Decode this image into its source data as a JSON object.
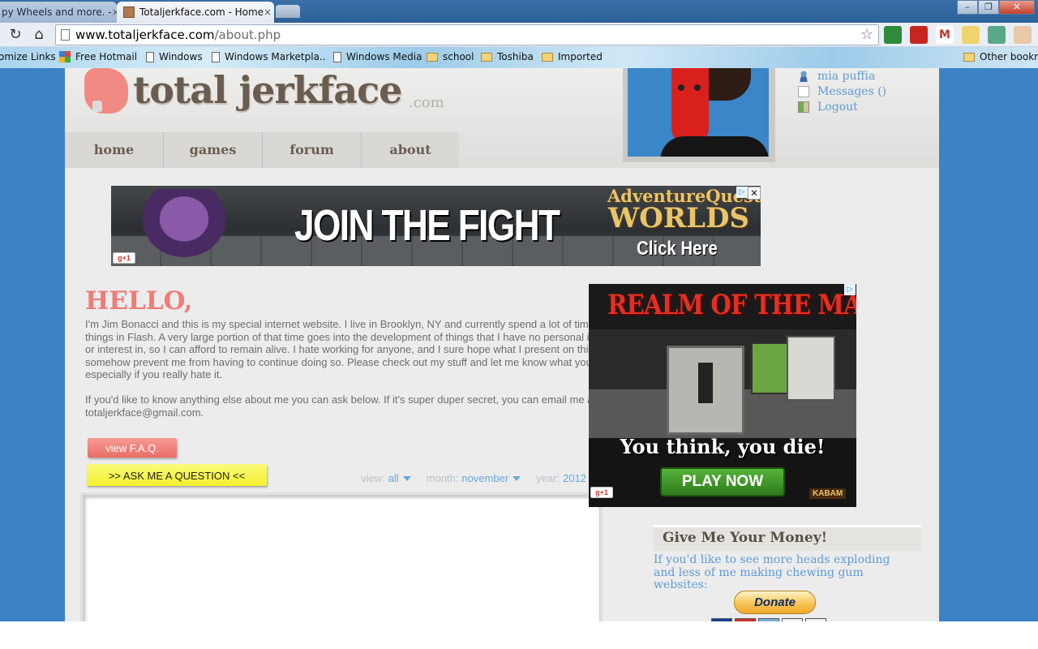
{
  "browser": {
    "tabs": [
      {
        "label": "py Wheels and more. -",
        "active": false
      },
      {
        "label": "Totaljerkface.com - Home",
        "active": true
      }
    ],
    "url_host": "www.totaljerkface.com",
    "url_path": "/about.php",
    "bookmarks": [
      {
        "label": "omize Links",
        "icon": "none"
      },
      {
        "label": "Free Hotmail",
        "icon": "windows-logo-icon"
      },
      {
        "label": "Windows",
        "icon": "page-icon"
      },
      {
        "label": "Windows Marketpla..",
        "icon": "page-icon"
      },
      {
        "label": "Windows Media",
        "icon": "page-icon"
      },
      {
        "label": "school",
        "icon": "folder-icon"
      },
      {
        "label": "Toshiba",
        "icon": "folder-icon"
      },
      {
        "label": "Imported",
        "icon": "folder-icon"
      }
    ],
    "other_bookmarks": "Other bookm",
    "close_glyph": "×",
    "reload_glyph": "↻",
    "home_glyph": "⌂",
    "star_glyph": "☆",
    "win_glyphs": {
      "minimize": "–",
      "restore": "❐",
      "close": "✕"
    }
  },
  "site": {
    "logo_text": "total jerkface",
    "logo_suffix": ".com",
    "nav": [
      "home",
      "games",
      "forum",
      "about"
    ],
    "user_menu": {
      "username": "mia puffia",
      "messages": "Messages ()",
      "logout": "Logout"
    },
    "top_ad": {
      "headline": "JOIN THE FIGHT",
      "brand_line1": "AdventureQuest",
      "brand_line2": "WORLDS",
      "cta": "Click Here",
      "gplus": "g+1",
      "choice": "▷",
      "close": "✕"
    },
    "side_ad": {
      "title": "REALM OF THE MAD GOD",
      "tagline": "You think, you die!",
      "cta": "PLAY NOW",
      "gplus": "g+1",
      "brand": "KABAM",
      "choice": "▷"
    },
    "about": {
      "heading": "HELLO,",
      "paragraph1": "I'm Jim Bonacci and this is my special internet website.  I live in Brooklyn, NY and currently spend a lot of time creating things in Flash.  A very large portion of that time goes into the development of things that I have no personal investment or interest in, so I can afford to remain alive.  I hate working for anyone, and I sure hope what I present on this site can somehow prevent me from having to continue doing so.  Please check out my stuff and let me know what you think ... especially if you really hate it.",
      "paragraph2": "If you'd like to know anything else about me you can ask below.  If it's super duper secret, you can email me at totaljerkface@gmail.com.",
      "faq_button": "view F.A.Q.",
      "ask_button": ">> ASK ME A QUESTION <<"
    },
    "filters": {
      "view_label": "view:",
      "view_value": "all",
      "month_label": "month:",
      "month_value": "november",
      "year_label": "year:",
      "year_value": "2012"
    },
    "money": {
      "heading": "Give Me Your Money!",
      "text": "If you'd like to see more heads exploding and less of me making chewing gum websites:",
      "donate_button": "Donate"
    }
  },
  "colors": {
    "background_blue": "#3c82c6",
    "heading_pink": "#f07c76",
    "link_blue": "#5e9bd6",
    "ask_yellow": "#f3ef2c"
  }
}
